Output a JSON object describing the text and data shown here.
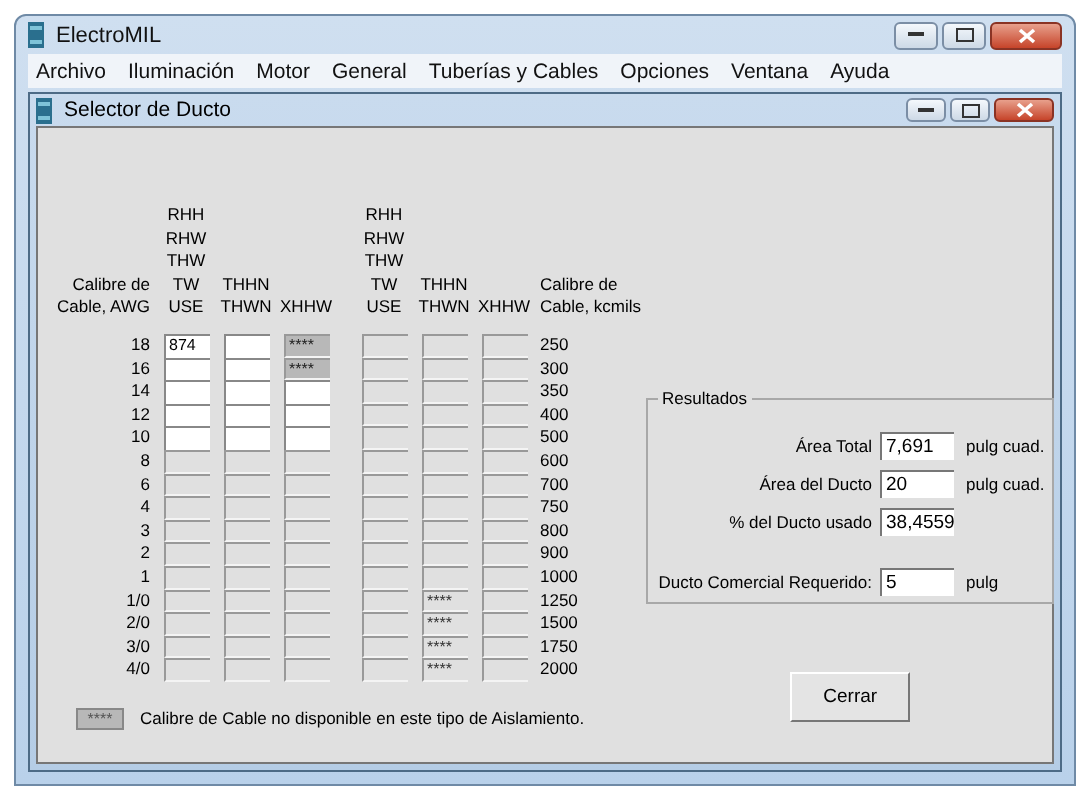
{
  "window": {
    "title": "ElectroMIL"
  },
  "menu": [
    "Archivo",
    "Iluminación",
    "Motor",
    "General",
    "Tuberías y Cables",
    "Opciones",
    "Ventana",
    "Ayuda"
  ],
  "child_window": {
    "title": "Selector de Ducto"
  },
  "groups": [
    {
      "size_header": "Calibre de\nCable, AWG",
      "columns": [
        "RHH\nRHW\nTHW\nTW\nUSE",
        "THHN\nTHWN",
        "XHHW"
      ],
      "rows": [
        {
          "size": "18",
          "cells": [
            {
              "value": "874",
              "enabled": true,
              "shaded": false
            },
            {
              "enabled": true,
              "shaded": false
            },
            {
              "value": "****",
              "enabled": false,
              "shaded": true
            }
          ]
        },
        {
          "size": "16",
          "cells": [
            {
              "enabled": true,
              "shaded": false
            },
            {
              "enabled": true,
              "shaded": false
            },
            {
              "value": "****",
              "enabled": false,
              "shaded": true
            }
          ]
        },
        {
          "size": "14",
          "cells": [
            {
              "enabled": true,
              "shaded": false
            },
            {
              "enabled": true,
              "shaded": false
            },
            {
              "enabled": true,
              "shaded": false
            }
          ]
        },
        {
          "size": "12",
          "cells": [
            {
              "enabled": true,
              "shaded": false
            },
            {
              "enabled": true,
              "shaded": false
            },
            {
              "enabled": true,
              "shaded": false
            }
          ]
        },
        {
          "size": "10",
          "cells": [
            {
              "enabled": true,
              "shaded": false
            },
            {
              "enabled": true,
              "shaded": false
            },
            {
              "enabled": true,
              "shaded": false
            }
          ]
        },
        {
          "size": "8",
          "cells": [
            {
              "enabled": false,
              "shaded": false
            },
            {
              "enabled": false,
              "shaded": false
            },
            {
              "enabled": false,
              "shaded": false
            }
          ]
        },
        {
          "size": "6",
          "cells": [
            {
              "enabled": false,
              "shaded": false
            },
            {
              "enabled": false,
              "shaded": false
            },
            {
              "enabled": false,
              "shaded": false
            }
          ]
        },
        {
          "size": "4",
          "cells": [
            {
              "enabled": false,
              "shaded": false
            },
            {
              "enabled": false,
              "shaded": false
            },
            {
              "enabled": false,
              "shaded": false
            }
          ]
        },
        {
          "size": "3",
          "cells": [
            {
              "enabled": false,
              "shaded": false
            },
            {
              "enabled": false,
              "shaded": false
            },
            {
              "enabled": false,
              "shaded": false
            }
          ]
        },
        {
          "size": "2",
          "cells": [
            {
              "enabled": false,
              "shaded": false
            },
            {
              "enabled": false,
              "shaded": false
            },
            {
              "enabled": false,
              "shaded": false
            }
          ]
        },
        {
          "size": "1",
          "cells": [
            {
              "enabled": false,
              "shaded": false
            },
            {
              "enabled": false,
              "shaded": false
            },
            {
              "enabled": false,
              "shaded": false
            }
          ]
        },
        {
          "size": "1/0",
          "cells": [
            {
              "enabled": false,
              "shaded": false
            },
            {
              "enabled": false,
              "shaded": false
            },
            {
              "enabled": false,
              "shaded": false
            }
          ]
        },
        {
          "size": "2/0",
          "cells": [
            {
              "enabled": false,
              "shaded": false
            },
            {
              "enabled": false,
              "shaded": false
            },
            {
              "enabled": false,
              "shaded": false
            }
          ]
        },
        {
          "size": "3/0",
          "cells": [
            {
              "enabled": false,
              "shaded": false
            },
            {
              "enabled": false,
              "shaded": false
            },
            {
              "enabled": false,
              "shaded": false
            }
          ]
        },
        {
          "size": "4/0",
          "cells": [
            {
              "enabled": false,
              "shaded": false
            },
            {
              "enabled": false,
              "shaded": false
            },
            {
              "enabled": false,
              "shaded": false
            }
          ]
        }
      ]
    },
    {
      "size_header": "Calibre de\nCable, kcmils",
      "columns": [
        "RHH\nRHW\nTHW\nTW\nUSE",
        "THHN\nTHWN",
        "XHHW"
      ],
      "rows": [
        {
          "size": "250",
          "cells": [
            {
              "enabled": false,
              "shaded": false
            },
            {
              "enabled": false,
              "shaded": false
            },
            {
              "enabled": false,
              "shaded": false
            }
          ]
        },
        {
          "size": "300",
          "cells": [
            {
              "enabled": false,
              "shaded": false
            },
            {
              "enabled": false,
              "shaded": false
            },
            {
              "enabled": false,
              "shaded": false
            }
          ]
        },
        {
          "size": "350",
          "cells": [
            {
              "enabled": false,
              "shaded": false
            },
            {
              "enabled": false,
              "shaded": false
            },
            {
              "enabled": false,
              "shaded": false
            }
          ]
        },
        {
          "size": "400",
          "cells": [
            {
              "enabled": false,
              "shaded": false
            },
            {
              "enabled": false,
              "shaded": false
            },
            {
              "enabled": false,
              "shaded": false
            }
          ]
        },
        {
          "size": "500",
          "cells": [
            {
              "enabled": false,
              "shaded": false
            },
            {
              "enabled": false,
              "shaded": false
            },
            {
              "enabled": false,
              "shaded": false
            }
          ]
        },
        {
          "size": "600",
          "cells": [
            {
              "enabled": false,
              "shaded": false
            },
            {
              "enabled": false,
              "shaded": false
            },
            {
              "enabled": false,
              "shaded": false
            }
          ]
        },
        {
          "size": "700",
          "cells": [
            {
              "enabled": false,
              "shaded": false
            },
            {
              "enabled": false,
              "shaded": false
            },
            {
              "enabled": false,
              "shaded": false
            }
          ]
        },
        {
          "size": "750",
          "cells": [
            {
              "enabled": false,
              "shaded": false
            },
            {
              "enabled": false,
              "shaded": false
            },
            {
              "enabled": false,
              "shaded": false
            }
          ]
        },
        {
          "size": "800",
          "cells": [
            {
              "enabled": false,
              "shaded": false
            },
            {
              "enabled": false,
              "shaded": false
            },
            {
              "enabled": false,
              "shaded": false
            }
          ]
        },
        {
          "size": "900",
          "cells": [
            {
              "enabled": false,
              "shaded": false
            },
            {
              "enabled": false,
              "shaded": false
            },
            {
              "enabled": false,
              "shaded": false
            }
          ]
        },
        {
          "size": "1000",
          "cells": [
            {
              "enabled": false,
              "shaded": false
            },
            {
              "enabled": false,
              "shaded": false
            },
            {
              "enabled": false,
              "shaded": false
            }
          ]
        },
        {
          "size": "1250",
          "cells": [
            {
              "enabled": false,
              "shaded": false
            },
            {
              "value": "****",
              "enabled": false,
              "shaded": false
            },
            {
              "enabled": false,
              "shaded": false
            }
          ]
        },
        {
          "size": "1500",
          "cells": [
            {
              "enabled": false,
              "shaded": false
            },
            {
              "value": "****",
              "enabled": false,
              "shaded": false
            },
            {
              "enabled": false,
              "shaded": false
            }
          ]
        },
        {
          "size": "1750",
          "cells": [
            {
              "enabled": false,
              "shaded": false
            },
            {
              "value": "****",
              "enabled": false,
              "shaded": false
            },
            {
              "enabled": false,
              "shaded": false
            }
          ]
        },
        {
          "size": "2000",
          "cells": [
            {
              "enabled": false,
              "shaded": false
            },
            {
              "value": "****",
              "enabled": false,
              "shaded": false
            },
            {
              "enabled": false,
              "shaded": false
            }
          ]
        }
      ]
    }
  ],
  "legend": {
    "swatch": "****",
    "text": "Calibre de Cable no disponible en este tipo de Aislamiento."
  },
  "results": {
    "title": "Resultados",
    "fields": [
      {
        "label": "Área Total",
        "value": "7,691",
        "unit": "pulg cuad."
      },
      {
        "label": "Área del Ducto",
        "value": "20",
        "unit": "pulg cuad."
      },
      {
        "label": "% del Ducto usado",
        "value": "38,4559"
      },
      {
        "label": "Ducto Comercial Requerido:",
        "value": "5",
        "unit": "pulg"
      }
    ]
  },
  "close_button": "Cerrar"
}
